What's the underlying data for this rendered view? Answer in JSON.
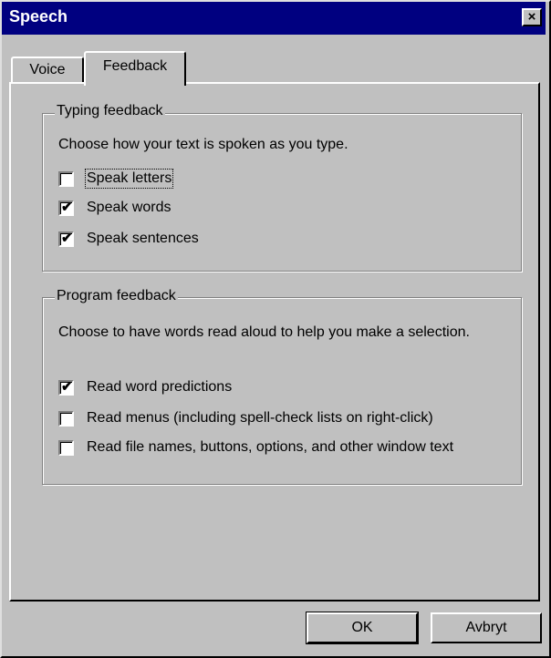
{
  "window": {
    "title": "Speech",
    "close_glyph": "×"
  },
  "tabs": [
    {
      "label": "Voice",
      "active": false
    },
    {
      "label": "Feedback",
      "active": true
    }
  ],
  "typing_feedback": {
    "legend": "Typing feedback",
    "description": "Choose how your text is spoken as you type.",
    "options": [
      {
        "label": "Speak letters",
        "checked": false
      },
      {
        "label": "Speak words",
        "checked": true
      },
      {
        "label": "Speak sentences",
        "checked": true
      }
    ]
  },
  "program_feedback": {
    "legend": "Program feedback",
    "description": "Choose to have words read aloud to help you make a selection.",
    "options": [
      {
        "label": "Read word predictions",
        "checked": true
      },
      {
        "label": "Read menus (including spell-check lists on right-click)",
        "checked": false
      },
      {
        "label": "Read file names, buttons, options, and other window text",
        "checked": false
      }
    ]
  },
  "buttons": {
    "ok_label": "OK",
    "cancel_label": "Avbryt"
  },
  "icons": {
    "check": "✔"
  }
}
